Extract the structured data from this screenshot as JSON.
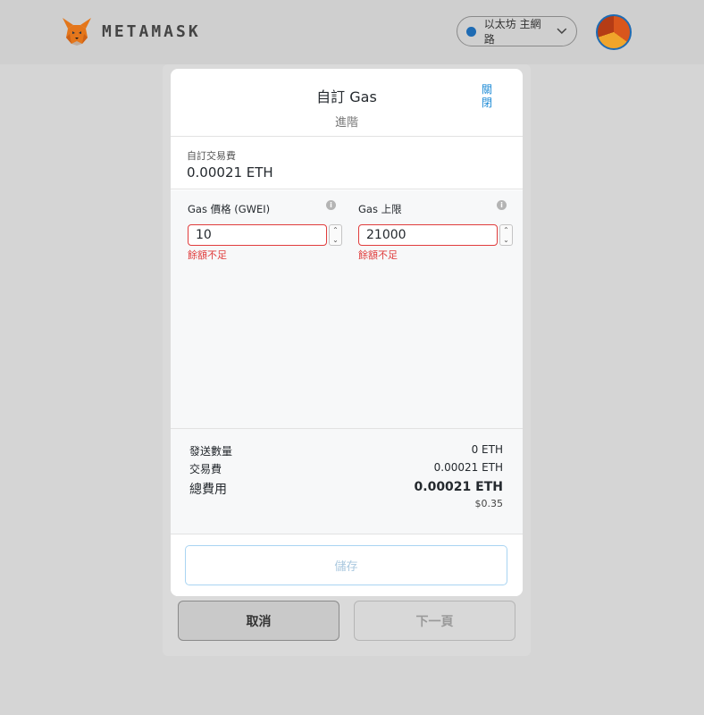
{
  "app": {
    "brand": "METAMASK"
  },
  "network": {
    "label": "以太坊 主網路",
    "dot_color": "#1e6bb3"
  },
  "modal": {
    "title": "自訂 Gas",
    "subtitle": "進階",
    "close_label": "關閉",
    "fee": {
      "label": "自訂交易費",
      "value": "0.00021 ETH"
    },
    "gas_price": {
      "label": "Gas 價格 (GWEI)",
      "value": "10",
      "error": "餘額不足"
    },
    "gas_limit": {
      "label": "Gas 上限",
      "value": "21000",
      "error": "餘額不足"
    },
    "summary": {
      "send_amount_label": "發送數量",
      "send_amount_value": "0 ETH",
      "tx_fee_label": "交易費",
      "tx_fee_value": "0.00021 ETH",
      "total_label": "總費用",
      "total_value": "0.00021 ETH",
      "total_usd": "$0.35"
    },
    "save_label": "儲存"
  },
  "background": {
    "cancel_label": "取消",
    "next_label": "下一頁"
  },
  "colors": {
    "accent": "#1e8bd6",
    "error": "#e03c3c"
  },
  "icons": [
    "metamask-fox-icon",
    "chevron-down-icon",
    "info-icon",
    "stepper-up-icon",
    "stepper-down-icon"
  ]
}
